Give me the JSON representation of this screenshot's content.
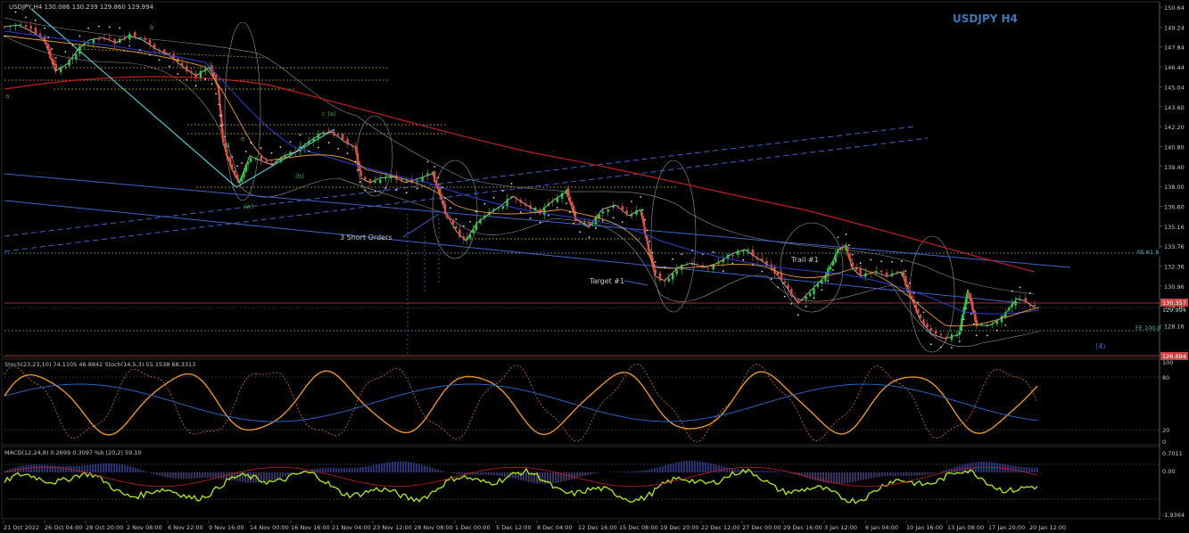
{
  "chart": {
    "symbol_line": "USDJPY,H4  130.086 130.239 129.860 129.994",
    "title": "USDJPY H4",
    "price_ticks": [
      "150.64",
      "149.24",
      "147.84",
      "146.44",
      "145.04",
      "143.60",
      "142.20",
      "140.80",
      "139.40",
      "138.00",
      "136.60",
      "135.16",
      "133.76",
      "132.36",
      "130.96",
      "129.56",
      "128.16"
    ],
    "current_price": "130.357",
    "bid_price": "129.994",
    "bottom_price": "126.694",
    "fe_618": "FE 61.8",
    "fe_100": "FE 100.0",
    "annotations": {
      "short_orders": "3 Short Orders",
      "target1": "Target #1",
      "trail": "Trail #1",
      "wave4": "(4)",
      "wave_a": "a",
      "wave_b": "b",
      "wave_c": "c",
      "wave_ca": "c (a)",
      "wave_e": "e",
      "wave_d": "d",
      "wave_wa": "(w)",
      "wave_wb": "(b)"
    },
    "colors": {
      "background": "#000000",
      "bull_candle": "#2ecc40",
      "bear_candle": "#e05040",
      "ma_red": "#c0201e",
      "ma_blue": "#2a40d0",
      "ma_orange": "#e8a040",
      "channel_blue": "#3c64c8",
      "fib_gold": "#c8a020",
      "title": "#3f78b8"
    }
  },
  "stoch": {
    "header": "Stoch(23,23,10) 74.1105 46.8842  Stoch(14,5,3) 55.1538 68.3313",
    "levels": [
      "100",
      "80",
      "20",
      "0"
    ]
  },
  "macd": {
    "header": "MACD(12,24,8) 0.2699 0.3097  %b (20,2) 59.10",
    "levels": [
      "0.7011",
      "0.00",
      "-1.9364"
    ]
  },
  "time_axis": [
    "21 Oct 2022",
    "26 Oct 04:00",
    "28 Oct 20:00",
    "2 Nov 08:00",
    "6 Nov 22:00",
    "9 Nov 16:00",
    "14 Nov 00:00",
    "16 Nov 16:00",
    "21 Nov 04:00",
    "23 Nov 12:00",
    "28 Nov 08:00",
    "1 Dec 00:00",
    "5 Dec 12:00",
    "8 Dec 04:00",
    "12 Dec 16:00",
    "15 Dec 08:00",
    "19 Dec 20:00",
    "22 Dec 12:00",
    "27 Dec 00:00",
    "29 Dec 16:00",
    "3 Jan 12:00",
    "6 Jan 04:00",
    "10 Jan 16:00",
    "13 Jan 08:00",
    "17 Jan 20:00",
    "20 Jan 12:00"
  ]
}
